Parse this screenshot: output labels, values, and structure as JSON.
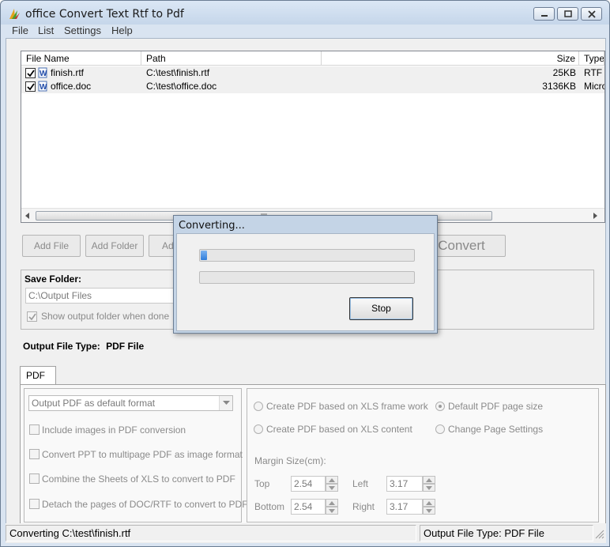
{
  "window": {
    "title": "office Convert Text Rtf to Pdf"
  },
  "menu": [
    "File",
    "List",
    "Settings",
    "Help"
  ],
  "file_list": {
    "columns": [
      "File Name",
      "Path",
      "Size",
      "Type"
    ],
    "rows": [
      {
        "name": "finish.rtf",
        "path": "C:\\test\\finish.rtf",
        "size": "25KB",
        "type": "RTF"
      },
      {
        "name": "office.doc",
        "path": "C:\\test\\office.doc",
        "size": "3136KB",
        "type": "Micro"
      }
    ]
  },
  "toolbar": {
    "add_file": "Add File",
    "add_folder": "Add Folder",
    "add_partial": "Ad",
    "convert": "Convert"
  },
  "save_folder": {
    "label": "Save Folder:",
    "path": "C:\\Output Files",
    "show_output_label": "Show output folder when done"
  },
  "output_type": {
    "label": "Output File Type:",
    "value": "PDF File"
  },
  "pdf_tab": {
    "label": "PDF",
    "format_select": "Output PDF as default format",
    "options": [
      "Include images in PDF conversion",
      "Convert PPT to multipage PDF as image format",
      "Combine the Sheets of XLS to convert to PDF",
      "Detach the pages of DOC/RTF to convert to PDF"
    ],
    "radios": {
      "xls_frame": "Create PDF based on XLS frame work",
      "xls_content": "Create PDF based on XLS content",
      "default_page": "Default PDF page size",
      "change_page": "Change Page Settings"
    },
    "margin": {
      "label": "Margin Size(cm):",
      "top_label": "Top",
      "top": "2.54",
      "left_label": "Left",
      "left": "3.17",
      "bottom_label": "Bottom",
      "bottom": "2.54",
      "right_label": "Right",
      "right": "3.17"
    }
  },
  "status": {
    "left": "Converting  C:\\test\\finish.rtf",
    "right": "Output File Type:  PDF File"
  },
  "dialog": {
    "title": "Converting...",
    "progress_fraction": 0.03,
    "stop": "Stop"
  },
  "colors": {
    "progress": "#2f7ddb",
    "window_frame": "#c4d4e6"
  }
}
